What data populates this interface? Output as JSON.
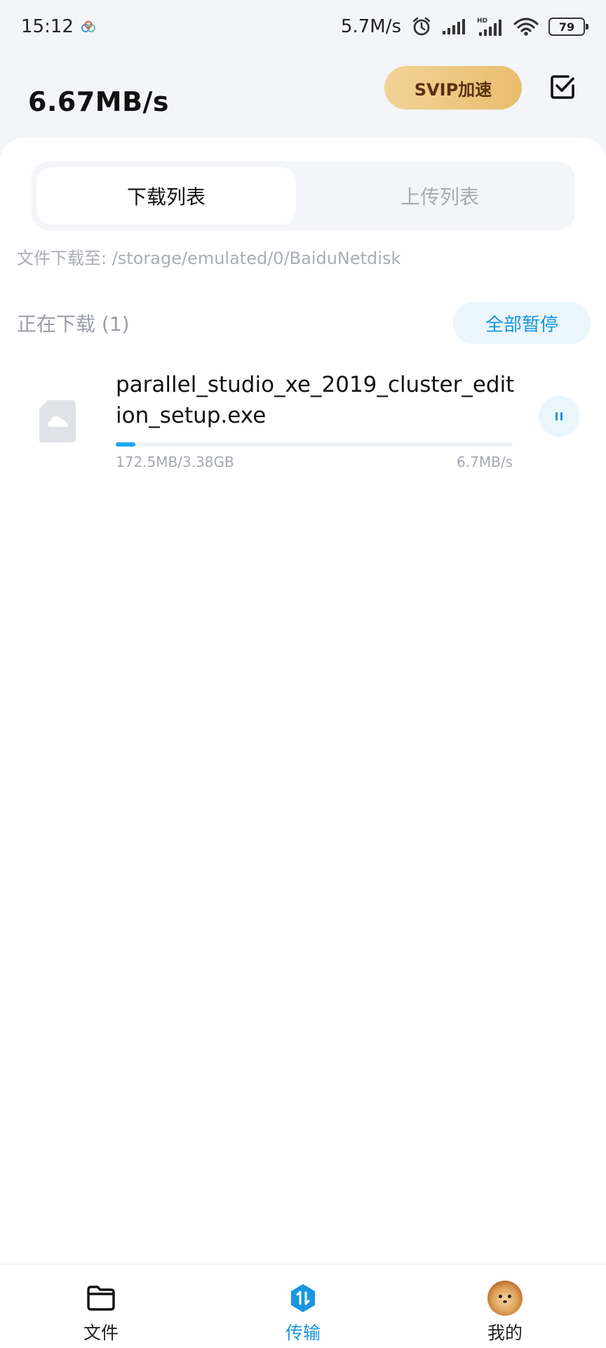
{
  "status_bar": {
    "time": "15:12",
    "net_speed": "5.7M/s",
    "battery": "79"
  },
  "header": {
    "speed": "6.67MB/s",
    "svip_label": "SVIP加速"
  },
  "tabs": [
    {
      "label": "下载列表",
      "active": true
    },
    {
      "label": "上传列表",
      "active": false
    }
  ],
  "download_path": "文件下载至: /storage/emulated/0/BaiduNetdisk",
  "section": {
    "title": "正在下载 (1)",
    "pause_all_label": "全部暂停"
  },
  "downloads": [
    {
      "name": "parallel_studio_xe_2019_cluster_edition_setup.exe",
      "size_progress": "172.5MB/3.38GB",
      "speed": "6.7MB/s",
      "progress_fraction": 0.05
    }
  ],
  "bottom_nav": [
    {
      "label": "文件",
      "icon": "folder-icon",
      "active": false
    },
    {
      "label": "传输",
      "icon": "transfer-icon",
      "active": true
    },
    {
      "label": "我的",
      "icon": "avatar",
      "active": false
    }
  ],
  "colors": {
    "accent": "#1a96e0",
    "svip_gradient_start": "#f2d396",
    "svip_gradient_end": "#e9bd6f",
    "background": "#f3f5f9"
  }
}
